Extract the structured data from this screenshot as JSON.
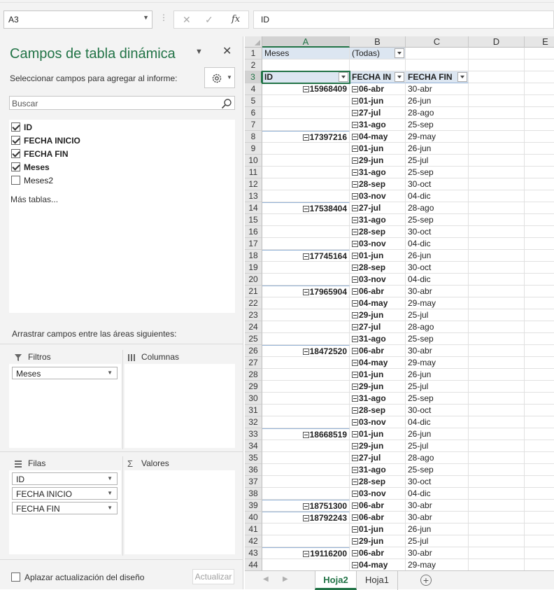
{
  "formula_bar": {
    "name_box": "A3",
    "cancel_icon": "✕",
    "enter_icon": "✓",
    "fx": "fx",
    "value": "ID"
  },
  "pivot_pane": {
    "title": "Campos de tabla dinámica",
    "subtitle": "Seleccionar campos para agregar al informe:",
    "search_placeholder": "Buscar",
    "fields": [
      {
        "label": "ID",
        "checked": true
      },
      {
        "label": "FECHA INICIO",
        "checked": true
      },
      {
        "label": "FECHA FIN",
        "checked": true
      },
      {
        "label": "Meses",
        "checked": true
      },
      {
        "label": "Meses2",
        "checked": false
      }
    ],
    "more_tables": "Más tablas...",
    "drag_label": "Arrastrar campos entre las áreas siguientes:",
    "areas": {
      "filters": {
        "title": "Filtros",
        "items": [
          "Meses"
        ]
      },
      "columns": {
        "title": "Columnas",
        "items": []
      },
      "rows": {
        "title": "Filas",
        "items": [
          "ID",
          "FECHA INICIO",
          "FECHA FIN"
        ]
      },
      "values": {
        "title": "Valores",
        "items": []
      }
    },
    "defer_label": "Aplazar actualización del diseño",
    "update_button": "Actualizar"
  },
  "sheet": {
    "columns": [
      "A",
      "B",
      "C",
      "D",
      "E"
    ],
    "filter_row": {
      "label": "Meses",
      "value": "(Todas)"
    },
    "headers": [
      "ID",
      "FECHA IN",
      "FECHA FIN"
    ],
    "rows": [
      {
        "id": "15968409",
        "ini": "06-abr",
        "fin": "30-abr"
      },
      {
        "id": "",
        "ini": "01-jun",
        "fin": "26-jun"
      },
      {
        "id": "",
        "ini": "27-jul",
        "fin": "28-ago"
      },
      {
        "id": "",
        "ini": "31-ago",
        "fin": "25-sep"
      },
      {
        "id": "17397216",
        "ini": "04-may",
        "fin": "29-may"
      },
      {
        "id": "",
        "ini": "01-jun",
        "fin": "26-jun"
      },
      {
        "id": "",
        "ini": "29-jun",
        "fin": "25-jul"
      },
      {
        "id": "",
        "ini": "31-ago",
        "fin": "25-sep"
      },
      {
        "id": "",
        "ini": "28-sep",
        "fin": "30-oct"
      },
      {
        "id": "",
        "ini": "03-nov",
        "fin": "04-dic"
      },
      {
        "id": "17538404",
        "ini": "27-jul",
        "fin": "28-ago"
      },
      {
        "id": "",
        "ini": "31-ago",
        "fin": "25-sep"
      },
      {
        "id": "",
        "ini": "28-sep",
        "fin": "30-oct"
      },
      {
        "id": "",
        "ini": "03-nov",
        "fin": "04-dic"
      },
      {
        "id": "17745164",
        "ini": "01-jun",
        "fin": "26-jun"
      },
      {
        "id": "",
        "ini": "28-sep",
        "fin": "30-oct"
      },
      {
        "id": "",
        "ini": "03-nov",
        "fin": "04-dic"
      },
      {
        "id": "17965904",
        "ini": "06-abr",
        "fin": "30-abr"
      },
      {
        "id": "",
        "ini": "04-may",
        "fin": "29-may"
      },
      {
        "id": "",
        "ini": "29-jun",
        "fin": "25-jul"
      },
      {
        "id": "",
        "ini": "27-jul",
        "fin": "28-ago"
      },
      {
        "id": "",
        "ini": "31-ago",
        "fin": "25-sep"
      },
      {
        "id": "18472520",
        "ini": "06-abr",
        "fin": "30-abr"
      },
      {
        "id": "",
        "ini": "04-may",
        "fin": "29-may"
      },
      {
        "id": "",
        "ini": "01-jun",
        "fin": "26-jun"
      },
      {
        "id": "",
        "ini": "29-jun",
        "fin": "25-jul"
      },
      {
        "id": "",
        "ini": "31-ago",
        "fin": "25-sep"
      },
      {
        "id": "",
        "ini": "28-sep",
        "fin": "30-oct"
      },
      {
        "id": "",
        "ini": "03-nov",
        "fin": "04-dic"
      },
      {
        "id": "18668519",
        "ini": "01-jun",
        "fin": "26-jun"
      },
      {
        "id": "",
        "ini": "29-jun",
        "fin": "25-jul"
      },
      {
        "id": "",
        "ini": "27-jul",
        "fin": "28-ago"
      },
      {
        "id": "",
        "ini": "31-ago",
        "fin": "25-sep"
      },
      {
        "id": "",
        "ini": "28-sep",
        "fin": "30-oct"
      },
      {
        "id": "",
        "ini": "03-nov",
        "fin": "04-dic"
      },
      {
        "id": "18751300",
        "ini": "06-abr",
        "fin": "30-abr"
      },
      {
        "id": "18792243",
        "ini": "06-abr",
        "fin": "30-abr"
      },
      {
        "id": "",
        "ini": "01-jun",
        "fin": "26-jun"
      },
      {
        "id": "",
        "ini": "29-jun",
        "fin": "25-jul"
      },
      {
        "id": "19116200",
        "ini": "06-abr",
        "fin": "30-abr"
      },
      {
        "id": "",
        "ini": "04-may",
        "fin": "29-may"
      }
    ]
  },
  "tabs": {
    "sheets": [
      "Hoja2",
      "Hoja1"
    ],
    "active": "Hoja2",
    "add_label": "+"
  },
  "colors": {
    "accent": "#217346",
    "pivot_header": "#dce6f1"
  }
}
